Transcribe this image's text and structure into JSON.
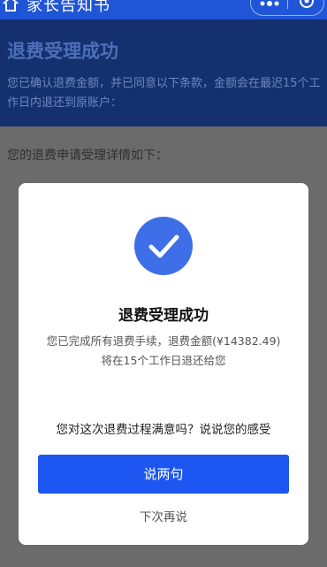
{
  "header": {
    "title": "家长告知书"
  },
  "banner": {
    "title": "退费受理成功",
    "text": "您已确认退费金额，并已同意以下条款，金额会在最迟15个工作日内退还到原账户："
  },
  "detail": {
    "title": "您的退费申请受理详情如下："
  },
  "modal": {
    "title": "退费受理成功",
    "desc_line1": "您已完成所有退费手续，退费金额(¥14382.49)",
    "desc_line2": "将在15个工作日退还给您",
    "question": "您对这次退费过程满意吗？说说您的感受",
    "primary_label": "说两句",
    "secondary_label": "下次再说"
  },
  "icons": {
    "home": "home-icon",
    "more": "more-dots-icon",
    "close": "close-circle-icon",
    "success": "checkmark-circle-icon"
  },
  "colors": {
    "brand_blue": "#1d56f0",
    "banner_bg": "#14306f",
    "success_circle": "#3f6ee9"
  }
}
